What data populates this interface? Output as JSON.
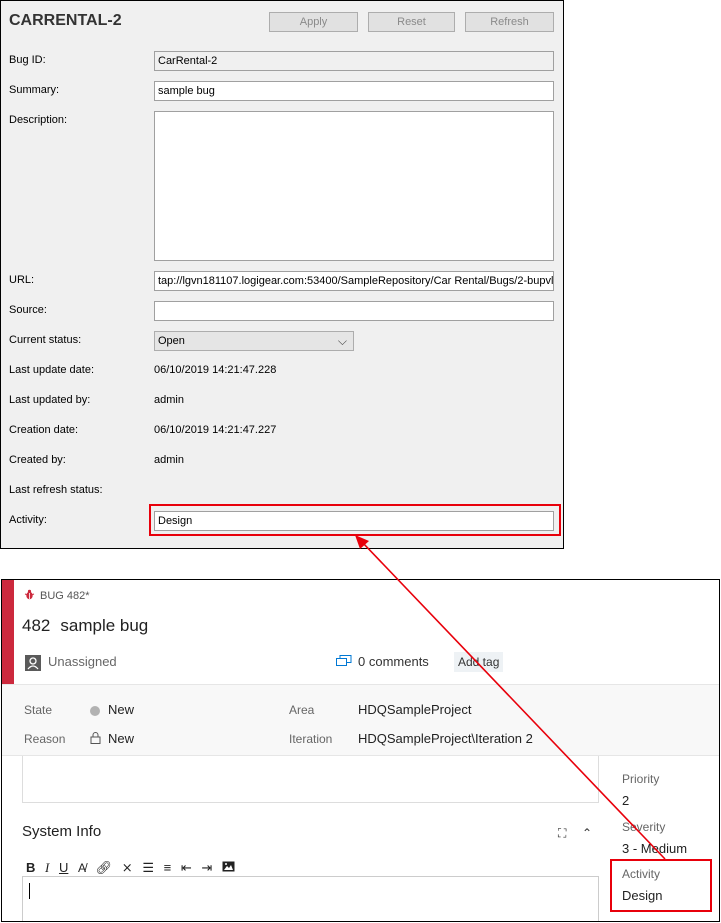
{
  "top_panel": {
    "title": "CARRENTAL-2",
    "buttons": {
      "apply": "Apply",
      "reset": "Reset",
      "refresh": "Refresh"
    },
    "labels": {
      "bug_id": "Bug ID:",
      "summary": "Summary:",
      "description": "Description:",
      "url": "URL:",
      "source": "Source:",
      "current_status": "Current status:",
      "last_update_date": "Last update date:",
      "last_updated_by": "Last updated by:",
      "creation_date": "Creation date:",
      "created_by": "Created by:",
      "last_refresh_status": "Last refresh status:",
      "activity": "Activity:"
    },
    "values": {
      "bug_id": "CarRental-2",
      "summary": "sample bug",
      "description": "",
      "url": "tap://lgvn181107.logigear.com:53400/SampleRepository/Car Rental/Bugs/2-bupvl",
      "source": "",
      "current_status": "Open",
      "last_update_date": "06/10/2019 14:21:47.228",
      "last_updated_by": "admin",
      "creation_date": "06/10/2019 14:21:47.227",
      "created_by": "admin",
      "last_refresh_status": "",
      "activity": "Design"
    }
  },
  "work_item": {
    "type_label": "BUG 482*",
    "id": "482",
    "title": "sample bug",
    "assignee": "Unassigned",
    "comments": "0 comments",
    "add_tag": "Add tag",
    "state_label": "State",
    "state_value": "New",
    "reason_label": "Reason",
    "reason_value": "New",
    "area_label": "Area",
    "area_value": "HDQSampleProject",
    "iteration_label": "Iteration",
    "iteration_value": "HDQSampleProject\\Iteration 2",
    "section_title": "System Info",
    "priority_label": "Priority",
    "priority_value": "2",
    "severity_label": "Severity",
    "severity_value": "3 - Medium",
    "activity_label": "Activity",
    "activity_value": "Design",
    "toolbar_icons": [
      "bold-icon",
      "italic-icon",
      "underline-icon",
      "format-icon",
      "link-icon",
      "unlink-icon",
      "bullet-list-icon",
      "numbered-list-icon",
      "outdent-icon",
      "indent-icon",
      "image-icon"
    ],
    "type_color": "#cc293d"
  },
  "annotation_color": "#e8000b"
}
